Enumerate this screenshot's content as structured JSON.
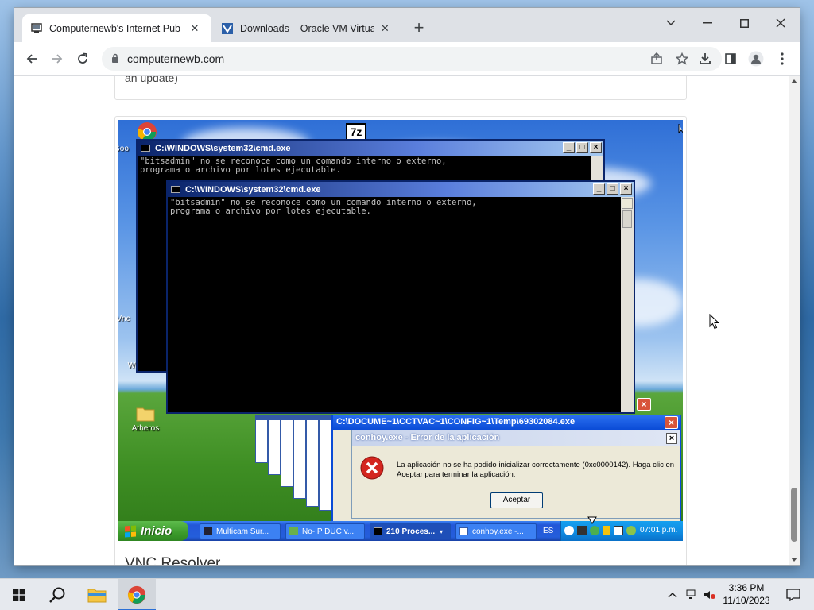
{
  "browser": {
    "tabs": [
      {
        "title": "Computernewb's Internet Pub Hub",
        "active": true
      },
      {
        "title": "Downloads – Oracle VM VirtualBox",
        "active": false
      }
    ],
    "url": "computernewb.com"
  },
  "page": {
    "prev_text": "an update)",
    "next_heading": "VNC Resolver"
  },
  "xp": {
    "desktop_icons": [
      {
        "label": "Goo",
        "icon": "chrome-icon"
      },
      {
        "label": "",
        "icon": "7zip-icon"
      },
      {
        "label": "WrarSUIes",
        "icon": "folder-icon"
      },
      {
        "label": "Atheros",
        "icon": "folder-icon"
      },
      {
        "label": "Vnc",
        "icon": "app-icon"
      }
    ],
    "cmd1": {
      "title": "C:\\WINDOWS\\system32\\cmd.exe",
      "lines": [
        "\"bitsadmin\" no se reconoce como un comando interno o externo,",
        "programa o archivo por lotes ejecutable."
      ]
    },
    "cmd2": {
      "title": "C:\\WINDOWS\\system32\\cmd.exe",
      "lines": [
        "\"bitsadmin\" no se reconoce como un comando interno o externo,",
        "programa o archivo por lotes ejecutable."
      ]
    },
    "temp_window_title": "C:\\DOCUME~1\\CCTVAC~1\\CONFIG~1\\Temp\\69302084.exe",
    "error": {
      "title": "conhoy.exe - Error de la aplicación",
      "message": "La aplicación no se ha podido inicializar correctamente (0xc0000142). Haga clic en Aceptar para terminar la aplicación.",
      "ok_label": "Aceptar"
    },
    "taskbar": {
      "start_label": "Inicio",
      "items": [
        "Multicam Sur...",
        "No-IP DUC v...",
        "210 Proces...",
        "conhoy.exe -..."
      ],
      "lang": "ES",
      "time": "07:01 p.m."
    }
  },
  "host": {
    "time": "3:36 PM",
    "date": "11/10/2023"
  }
}
